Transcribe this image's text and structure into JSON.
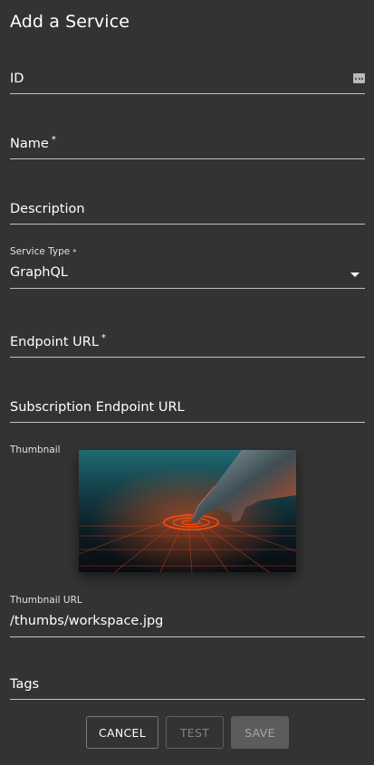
{
  "dialog": {
    "title": "Add a Service"
  },
  "fields": {
    "id": {
      "placeholder": "ID",
      "icon": "more-dots-icon"
    },
    "name": {
      "placeholder": "Name",
      "required_mark": "*"
    },
    "description": {
      "placeholder": "Description"
    },
    "service_type": {
      "label": "Service Type",
      "required_mark": "*",
      "value": "GraphQL",
      "icon": "caret-down-icon"
    },
    "endpoint_url": {
      "placeholder": "Endpoint URL",
      "required_mark": "*"
    },
    "subscription_endpoint_url": {
      "placeholder": "Subscription Endpoint URL"
    },
    "thumbnail": {
      "label": "Thumbnail"
    },
    "thumbnail_url": {
      "label": "Thumbnail URL",
      "value": "/thumbs/workspace.jpg"
    },
    "tags": {
      "placeholder": "Tags"
    }
  },
  "actions": {
    "cancel": "CANCEL",
    "test": "TEST",
    "save": "SAVE"
  },
  "colors": {
    "background": "#333333",
    "underline": "#b3b3b3",
    "save_disabled_bg": "#5c5c5c"
  }
}
